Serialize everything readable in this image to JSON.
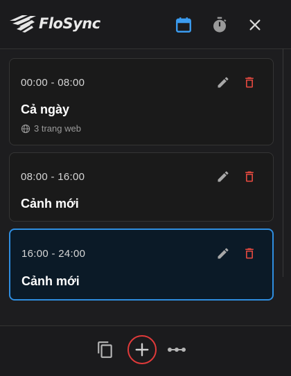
{
  "app": {
    "name": "FloSync"
  },
  "header": {
    "icons": [
      "calendar-icon",
      "timer-icon",
      "close-icon"
    ],
    "active_color": "#3b9cf0",
    "icon_color": "#9a9a9a"
  },
  "scenes": [
    {
      "time": "00:00 - 08:00",
      "name": "Cả ngày",
      "meta": "3 trang web",
      "active": false
    },
    {
      "time": "08:00 - 16:00",
      "name": "Cảnh mới",
      "active": false
    },
    {
      "time": "16:00 - 24:00",
      "name": "Cảnh mới",
      "active": true
    }
  ],
  "colors": {
    "accent": "#2f8ee0",
    "delete": "#e0483f",
    "highlight_ring": "#e03a3a"
  },
  "footer": {
    "icons": [
      "copy-icon",
      "add-icon",
      "more-icon"
    ]
  }
}
